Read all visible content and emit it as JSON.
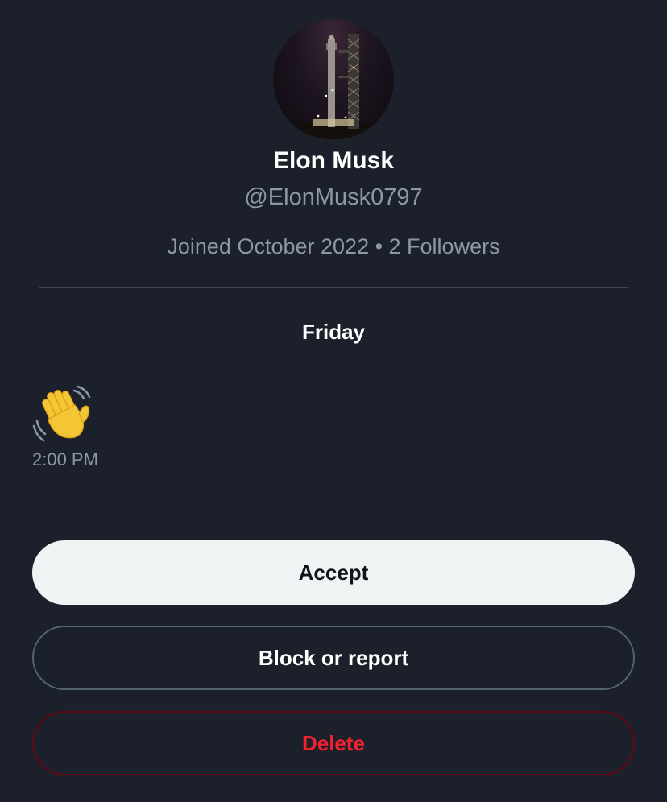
{
  "profile": {
    "name": "Elon Musk",
    "handle": "@ElonMusk0797",
    "meta": "Joined October 2022 • 2 Followers",
    "avatar_icon": "rocket-launch-tower-photo"
  },
  "conversation": {
    "day": "Friday",
    "messages": [
      {
        "content": "👋",
        "icon": "waving-hand-emoji",
        "time": "2:00 PM"
      }
    ]
  },
  "actions": {
    "accept_label": "Accept",
    "block_label": "Block or report",
    "delete_label": "Delete"
  },
  "colors": {
    "background": "#1b202b",
    "secondary_text": "#8b98a5",
    "accept_bg": "#eff3f4",
    "delete_red": "#f4212e"
  }
}
